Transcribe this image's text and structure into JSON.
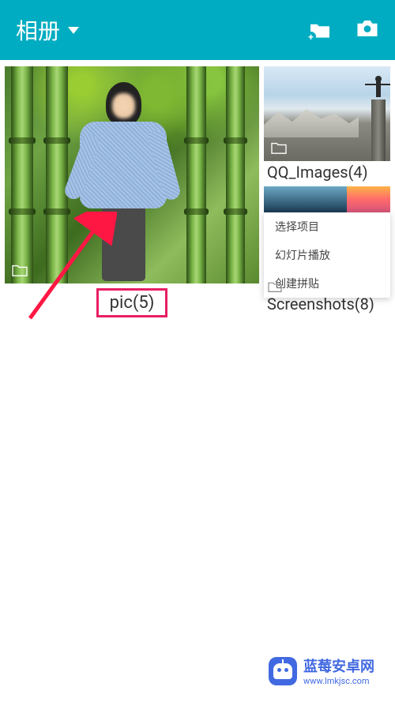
{
  "header": {
    "title": "相册"
  },
  "albums": {
    "main": {
      "label": "pic(5)"
    },
    "qq": {
      "label": "QQ_Images(4)"
    },
    "screenshots": {
      "label": "Screenshots(8)"
    }
  },
  "context_menu": {
    "items": [
      "选择项目",
      "幻灯片播放",
      "创建拼贴"
    ]
  },
  "watermark": {
    "title": "蓝莓安卓网",
    "url": "www.lmkjsc.com"
  },
  "colors": {
    "header_bg": "#00acc1",
    "highlight": "#e91e63",
    "watermark": "#4169e1"
  }
}
